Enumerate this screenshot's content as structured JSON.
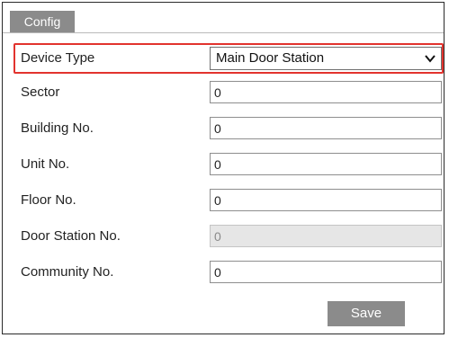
{
  "tabs": [
    {
      "label": "Config"
    }
  ],
  "form": {
    "device_type": {
      "label": "Device Type",
      "value": "Main Door Station"
    },
    "sector": {
      "label": "Sector",
      "value": "0"
    },
    "building_no": {
      "label": "Building No.",
      "value": "0"
    },
    "unit_no": {
      "label": "Unit No.",
      "value": "0"
    },
    "floor_no": {
      "label": "Floor No.",
      "value": "0"
    },
    "door_station_no": {
      "label": "Door Station No.",
      "value": "0"
    },
    "community_no": {
      "label": "Community No.",
      "value": "0"
    }
  },
  "actions": {
    "save_label": "Save"
  },
  "colors": {
    "highlight": "#e2332e",
    "tab_bg": "#8b8b8b",
    "button_bg": "#8b8b8b"
  }
}
